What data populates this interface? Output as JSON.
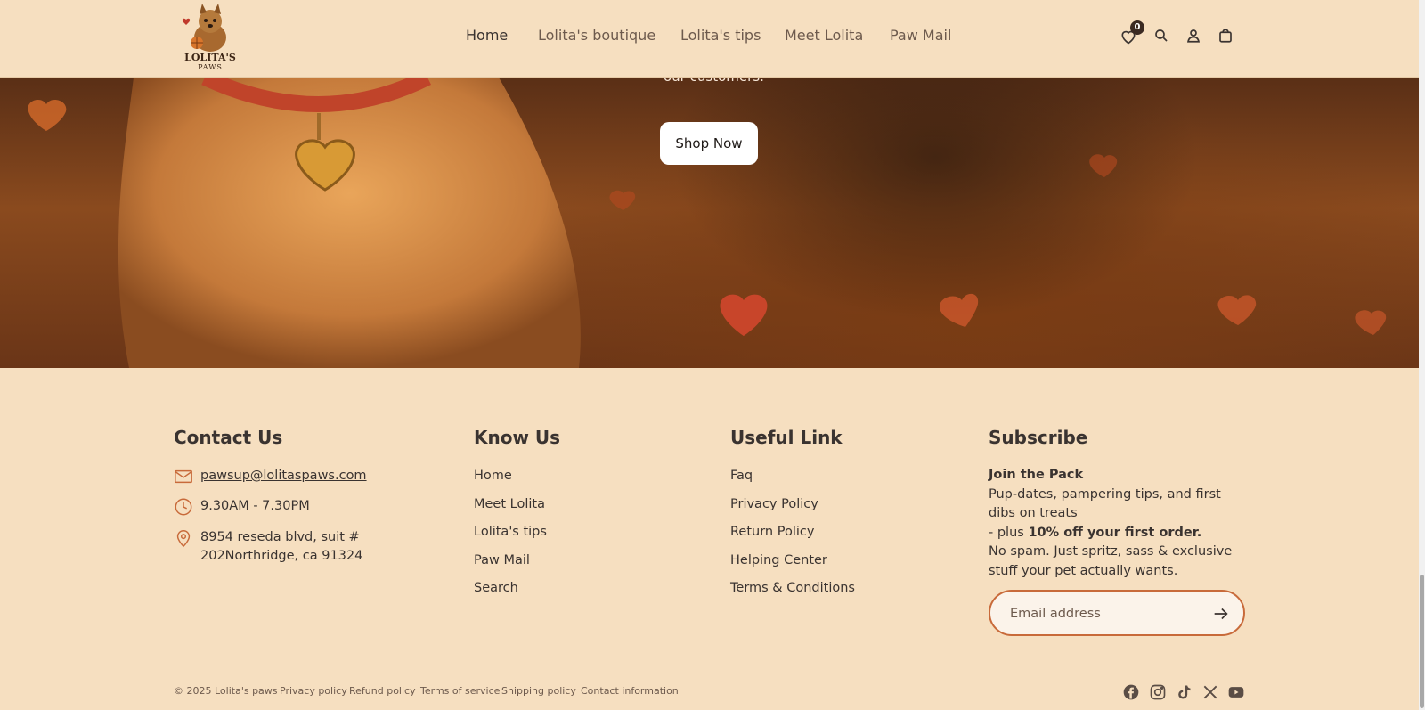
{
  "brand": {
    "logo_line1": "LOLITA'S",
    "logo_line2": "PAWS"
  },
  "nav": {
    "items": [
      {
        "label": "Home",
        "active": true
      },
      {
        "label": "Lolita's boutique"
      },
      {
        "label": "Lolita's tips"
      },
      {
        "label": "Meet Lolita"
      },
      {
        "label": "Paw Mail"
      }
    ]
  },
  "header_icons": {
    "wishlist_count": "0",
    "icons": [
      "heart-icon",
      "search-icon",
      "user-icon",
      "bag-icon"
    ]
  },
  "hero": {
    "text_fragment": "our customers.",
    "cta": "Shop Now"
  },
  "contact": {
    "title": "Contact Us",
    "email": "pawsup@lolitaspaws.com",
    "hours": "9.30AM - 7.30PM",
    "address_line1": "8954 reseda blvd, suit #",
    "address_line2": "202Northridge, ca 91324"
  },
  "know_us": {
    "title": "Know Us",
    "links": [
      "Home",
      "Meet Lolita",
      "Lolita's tips",
      "Paw Mail",
      "Search"
    ]
  },
  "useful": {
    "title": "Useful Link",
    "links": [
      "Faq",
      "Privacy Policy",
      "Return Policy",
      "Helping Center",
      "Terms & Conditions"
    ]
  },
  "subscribe": {
    "title": "Subscribe",
    "heading": "Join the Pack",
    "line1": "Pup-dates, pampering tips, and first dibs on treats",
    "line2_prefix": "- plus ",
    "line2_bold": "10% off your first order.",
    "line3": "No spam. Just spritz, sass & exclusive stuff your pet actually wants.",
    "email_placeholder": "Email address"
  },
  "footer": {
    "copyright": "© 2025 Lolita's paws",
    "policies": [
      "Privacy policy",
      "Refund policy",
      "Terms of service",
      "Shipping policy",
      "Contact information"
    ],
    "social": [
      "facebook-icon",
      "instagram-icon",
      "tiktok-icon",
      "x-icon",
      "youtube-icon"
    ]
  },
  "colors": {
    "background": "#f6dfc0",
    "accent": "#c86a3a",
    "text": "#3a3330"
  }
}
